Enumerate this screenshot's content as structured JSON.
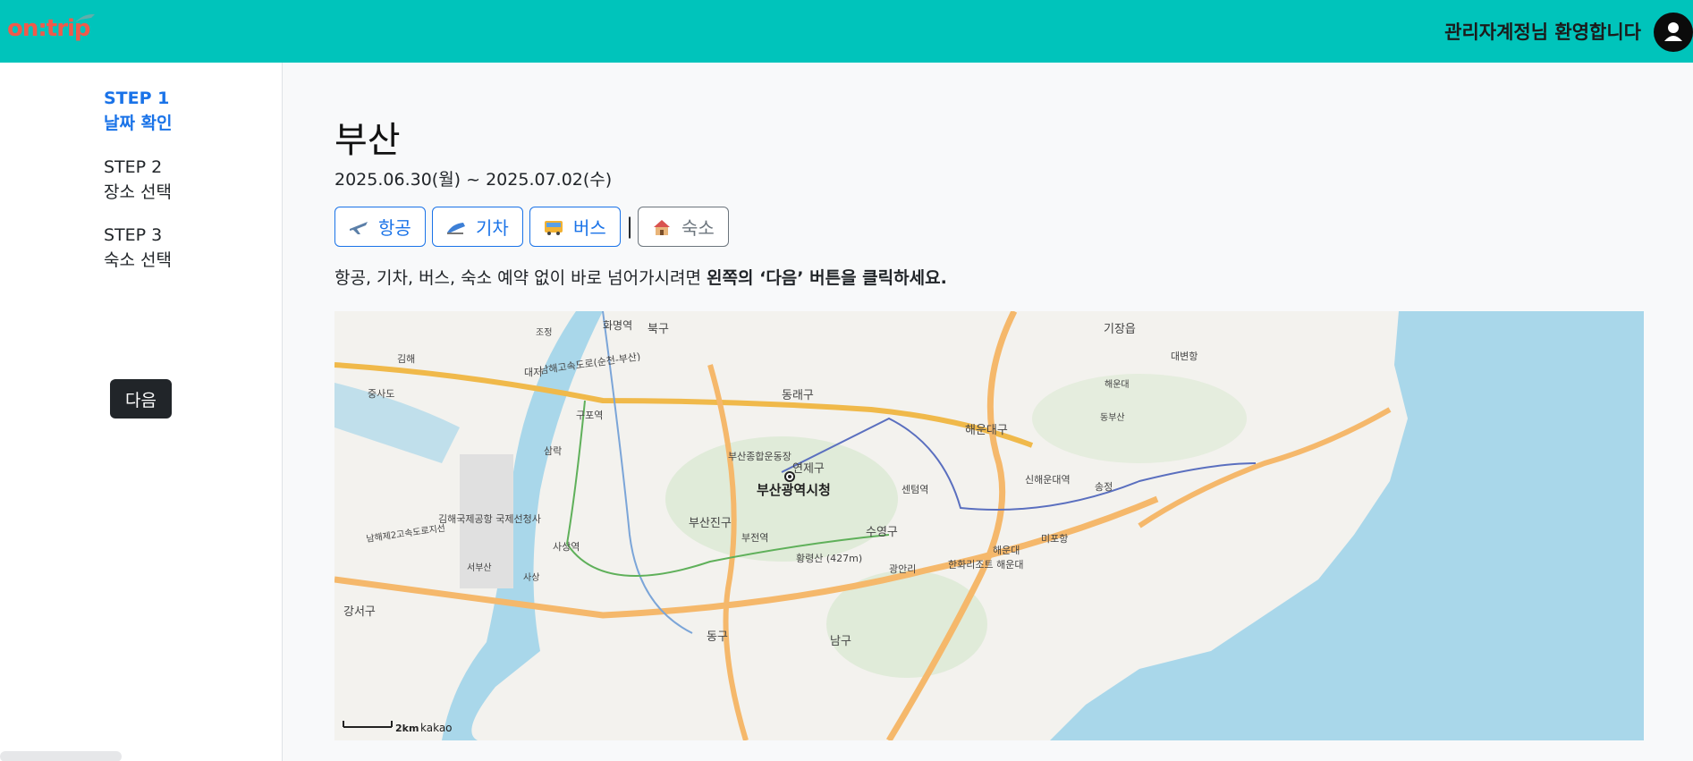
{
  "header": {
    "logo_text": "on:trip",
    "welcome": "관리자계정님 환영합니다"
  },
  "sidebar": {
    "steps": [
      {
        "line1": "STEP 1",
        "line2": "날짜 확인",
        "active": true
      },
      {
        "line1": "STEP 2",
        "line2": "장소 선택",
        "active": false
      },
      {
        "line1": "STEP 3",
        "line2": "숙소 선택",
        "active": false
      }
    ],
    "next_label": "다음"
  },
  "main": {
    "title": "부산",
    "date_range": "2025.06.30(월) ~ 2025.07.02(수)",
    "buttons": {
      "flight": "항공",
      "train": "기차",
      "bus": "버스",
      "separator": "|",
      "lodging": "숙소"
    },
    "notice_plain": "항공, 기차, 버스, 숙소 예약 없이 바로 넘어가시려면 ",
    "notice_bold": "왼쪽의 ‘다음’ 버튼을 클릭하세요."
  },
  "map": {
    "scale_label": "2km",
    "provider": "kakao",
    "marker_label": "부산광역시청",
    "places": [
      "화명역",
      "북구",
      "기장읍",
      "대변항",
      "조정",
      "남해고속도로(순천-부산)",
      "김해",
      "대저",
      "강서구",
      "동래구",
      "해운대",
      "동부산",
      "구포역",
      "해운대구",
      "삼락",
      "부산종합운동장",
      "연제구",
      "센텀역",
      "신해운대역",
      "송정",
      "김해국제공항 국제선청사",
      "부산진구",
      "수영구",
      "부전역",
      "사상역",
      "남해제2고속도로지선",
      "서부산",
      "사상",
      "황령산 (427m)",
      "광안리",
      "한화리조트 해운대",
      "해운대",
      "미포항",
      "동구",
      "남구",
      "중사도"
    ]
  },
  "colors": {
    "header_bg": "#00c4bb",
    "accent": "#1a73e8",
    "logo": "#f05a4b",
    "sea": "#a9d7ea"
  }
}
